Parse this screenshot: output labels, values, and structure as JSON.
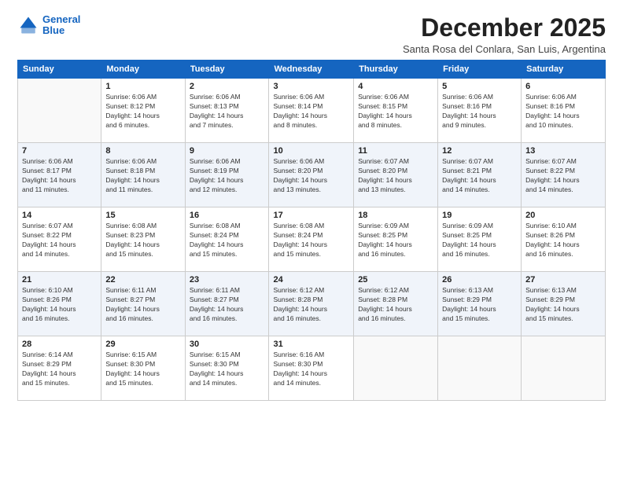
{
  "logo": {
    "line1": "General",
    "line2": "Blue"
  },
  "title": "December 2025",
  "subtitle": "Santa Rosa del Conlara, San Luis, Argentina",
  "weekdays": [
    "Sunday",
    "Monday",
    "Tuesday",
    "Wednesday",
    "Thursday",
    "Friday",
    "Saturday"
  ],
  "weeks": [
    [
      {
        "day": "",
        "info": ""
      },
      {
        "day": "1",
        "info": "Sunrise: 6:06 AM\nSunset: 8:12 PM\nDaylight: 14 hours\nand 6 minutes."
      },
      {
        "day": "2",
        "info": "Sunrise: 6:06 AM\nSunset: 8:13 PM\nDaylight: 14 hours\nand 7 minutes."
      },
      {
        "day": "3",
        "info": "Sunrise: 6:06 AM\nSunset: 8:14 PM\nDaylight: 14 hours\nand 8 minutes."
      },
      {
        "day": "4",
        "info": "Sunrise: 6:06 AM\nSunset: 8:15 PM\nDaylight: 14 hours\nand 8 minutes."
      },
      {
        "day": "5",
        "info": "Sunrise: 6:06 AM\nSunset: 8:16 PM\nDaylight: 14 hours\nand 9 minutes."
      },
      {
        "day": "6",
        "info": "Sunrise: 6:06 AM\nSunset: 8:16 PM\nDaylight: 14 hours\nand 10 minutes."
      }
    ],
    [
      {
        "day": "7",
        "info": "Sunrise: 6:06 AM\nSunset: 8:17 PM\nDaylight: 14 hours\nand 11 minutes."
      },
      {
        "day": "8",
        "info": "Sunrise: 6:06 AM\nSunset: 8:18 PM\nDaylight: 14 hours\nand 11 minutes."
      },
      {
        "day": "9",
        "info": "Sunrise: 6:06 AM\nSunset: 8:19 PM\nDaylight: 14 hours\nand 12 minutes."
      },
      {
        "day": "10",
        "info": "Sunrise: 6:06 AM\nSunset: 8:20 PM\nDaylight: 14 hours\nand 13 minutes."
      },
      {
        "day": "11",
        "info": "Sunrise: 6:07 AM\nSunset: 8:20 PM\nDaylight: 14 hours\nand 13 minutes."
      },
      {
        "day": "12",
        "info": "Sunrise: 6:07 AM\nSunset: 8:21 PM\nDaylight: 14 hours\nand 14 minutes."
      },
      {
        "day": "13",
        "info": "Sunrise: 6:07 AM\nSunset: 8:22 PM\nDaylight: 14 hours\nand 14 minutes."
      }
    ],
    [
      {
        "day": "14",
        "info": "Sunrise: 6:07 AM\nSunset: 8:22 PM\nDaylight: 14 hours\nand 14 minutes."
      },
      {
        "day": "15",
        "info": "Sunrise: 6:08 AM\nSunset: 8:23 PM\nDaylight: 14 hours\nand 15 minutes."
      },
      {
        "day": "16",
        "info": "Sunrise: 6:08 AM\nSunset: 8:24 PM\nDaylight: 14 hours\nand 15 minutes."
      },
      {
        "day": "17",
        "info": "Sunrise: 6:08 AM\nSunset: 8:24 PM\nDaylight: 14 hours\nand 15 minutes."
      },
      {
        "day": "18",
        "info": "Sunrise: 6:09 AM\nSunset: 8:25 PM\nDaylight: 14 hours\nand 16 minutes."
      },
      {
        "day": "19",
        "info": "Sunrise: 6:09 AM\nSunset: 8:25 PM\nDaylight: 14 hours\nand 16 minutes."
      },
      {
        "day": "20",
        "info": "Sunrise: 6:10 AM\nSunset: 8:26 PM\nDaylight: 14 hours\nand 16 minutes."
      }
    ],
    [
      {
        "day": "21",
        "info": "Sunrise: 6:10 AM\nSunset: 8:26 PM\nDaylight: 14 hours\nand 16 minutes."
      },
      {
        "day": "22",
        "info": "Sunrise: 6:11 AM\nSunset: 8:27 PM\nDaylight: 14 hours\nand 16 minutes."
      },
      {
        "day": "23",
        "info": "Sunrise: 6:11 AM\nSunset: 8:27 PM\nDaylight: 14 hours\nand 16 minutes."
      },
      {
        "day": "24",
        "info": "Sunrise: 6:12 AM\nSunset: 8:28 PM\nDaylight: 14 hours\nand 16 minutes."
      },
      {
        "day": "25",
        "info": "Sunrise: 6:12 AM\nSunset: 8:28 PM\nDaylight: 14 hours\nand 16 minutes."
      },
      {
        "day": "26",
        "info": "Sunrise: 6:13 AM\nSunset: 8:29 PM\nDaylight: 14 hours\nand 15 minutes."
      },
      {
        "day": "27",
        "info": "Sunrise: 6:13 AM\nSunset: 8:29 PM\nDaylight: 14 hours\nand 15 minutes."
      }
    ],
    [
      {
        "day": "28",
        "info": "Sunrise: 6:14 AM\nSunset: 8:29 PM\nDaylight: 14 hours\nand 15 minutes."
      },
      {
        "day": "29",
        "info": "Sunrise: 6:15 AM\nSunset: 8:30 PM\nDaylight: 14 hours\nand 15 minutes."
      },
      {
        "day": "30",
        "info": "Sunrise: 6:15 AM\nSunset: 8:30 PM\nDaylight: 14 hours\nand 14 minutes."
      },
      {
        "day": "31",
        "info": "Sunrise: 6:16 AM\nSunset: 8:30 PM\nDaylight: 14 hours\nand 14 minutes."
      },
      {
        "day": "",
        "info": ""
      },
      {
        "day": "",
        "info": ""
      },
      {
        "day": "",
        "info": ""
      }
    ]
  ]
}
